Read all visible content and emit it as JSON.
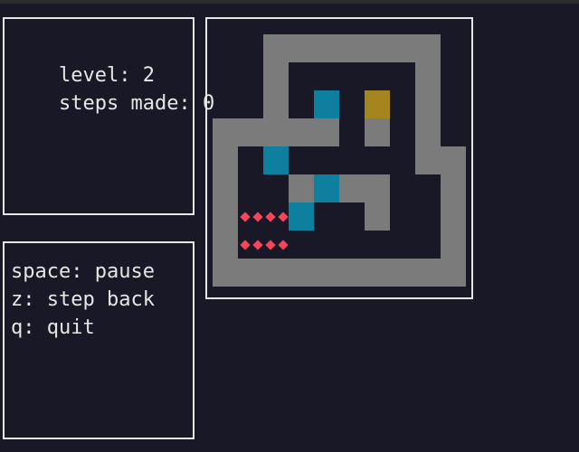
{
  "status": {
    "level_label": "level:",
    "level_value": "2",
    "steps_label": "steps made:",
    "steps_value": "0"
  },
  "help": {
    "pause": "space: pause",
    "step_back": "z: step back",
    "quit": "q: quit"
  },
  "colors": {
    "background": "#181826",
    "border": "#e6e6e6",
    "wall": "#7b7b7b",
    "box": "#0f7fa0",
    "player": "#a5851d",
    "goal": "#f4455d"
  },
  "board": {
    "legend": {
      "#": "wall",
      "B": "box",
      "P": "player",
      "G": "goal"
    },
    "rows": [
      "..#######.",
      "..#.....#.",
      "..#.B.P.#.",
      "#####.#.#.",
      "#.B.....##",
      "#..#B##..#",
      "#GGB..#..#",
      "#GG......#",
      "##########"
    ]
  }
}
